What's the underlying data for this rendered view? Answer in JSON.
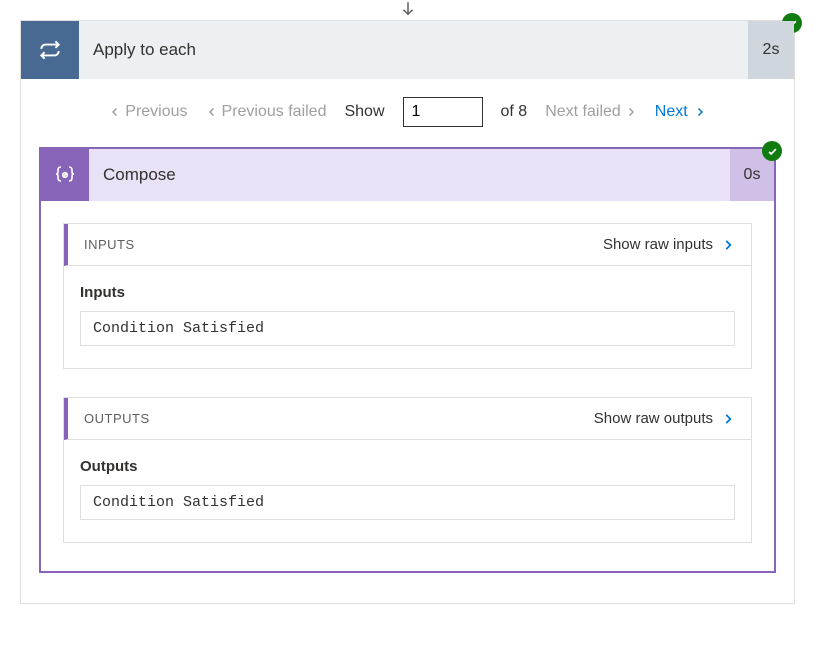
{
  "arrow": "↓",
  "applyToEach": {
    "title": "Apply to each",
    "duration": "2s",
    "status": "success"
  },
  "pager": {
    "previous": "Previous",
    "previousFailed": "Previous failed",
    "showLabel": "Show",
    "currentValue": "1",
    "ofLabel": "of 8",
    "nextFailed": "Next failed",
    "next": "Next"
  },
  "compose": {
    "title": "Compose",
    "iconGlyph": "{∅}",
    "duration": "0s",
    "status": "success",
    "inputs": {
      "sectionTitle": "INPUTS",
      "showRaw": "Show raw inputs",
      "fieldLabel": "Inputs",
      "fieldValue": "Condition Satisfied"
    },
    "outputs": {
      "sectionTitle": "OUTPUTS",
      "showRaw": "Show raw outputs",
      "fieldLabel": "Outputs",
      "fieldValue": "Condition Satisfied"
    }
  }
}
